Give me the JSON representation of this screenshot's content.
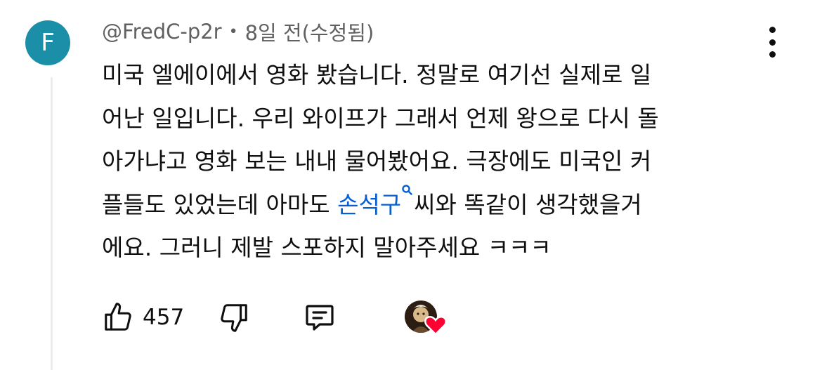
{
  "comment": {
    "avatar_letter": "F",
    "avatar_color": "#1b8fa8",
    "author": "@FredC-p2r",
    "separator": "•",
    "timestamp": "8일 전(수정됨)",
    "text": {
      "line1": "미국 엘에이에서 영화 봤습니다. 정말로 여기선 실제로 일",
      "line2": "어난 일입니다. 우리 와이프가 그래서 언제 왕으로 다시 돌",
      "line3": "아가냐고 영화 보는 내내 물어봤어요. 극장에도 미국인 커",
      "line4_before": "플들도 있었는데 아마도 ",
      "mention": "손석구",
      "line4_after": "씨와 똑같이 생각했을거",
      "line5": "에요. 그러니 제발 스포하지 말아주세요 ㅋㅋㅋ"
    },
    "like_count": "457",
    "icons": {
      "more": "more-vert-icon",
      "like": "thumbs-up-icon",
      "dislike": "thumbs-down-icon",
      "reply": "reply-comment-icon",
      "mention": "search-icon",
      "heart": "creator-heart-icon"
    },
    "colors": {
      "mention": "#065fd4",
      "heart": "#ff0033",
      "meta_text": "#606060"
    }
  }
}
